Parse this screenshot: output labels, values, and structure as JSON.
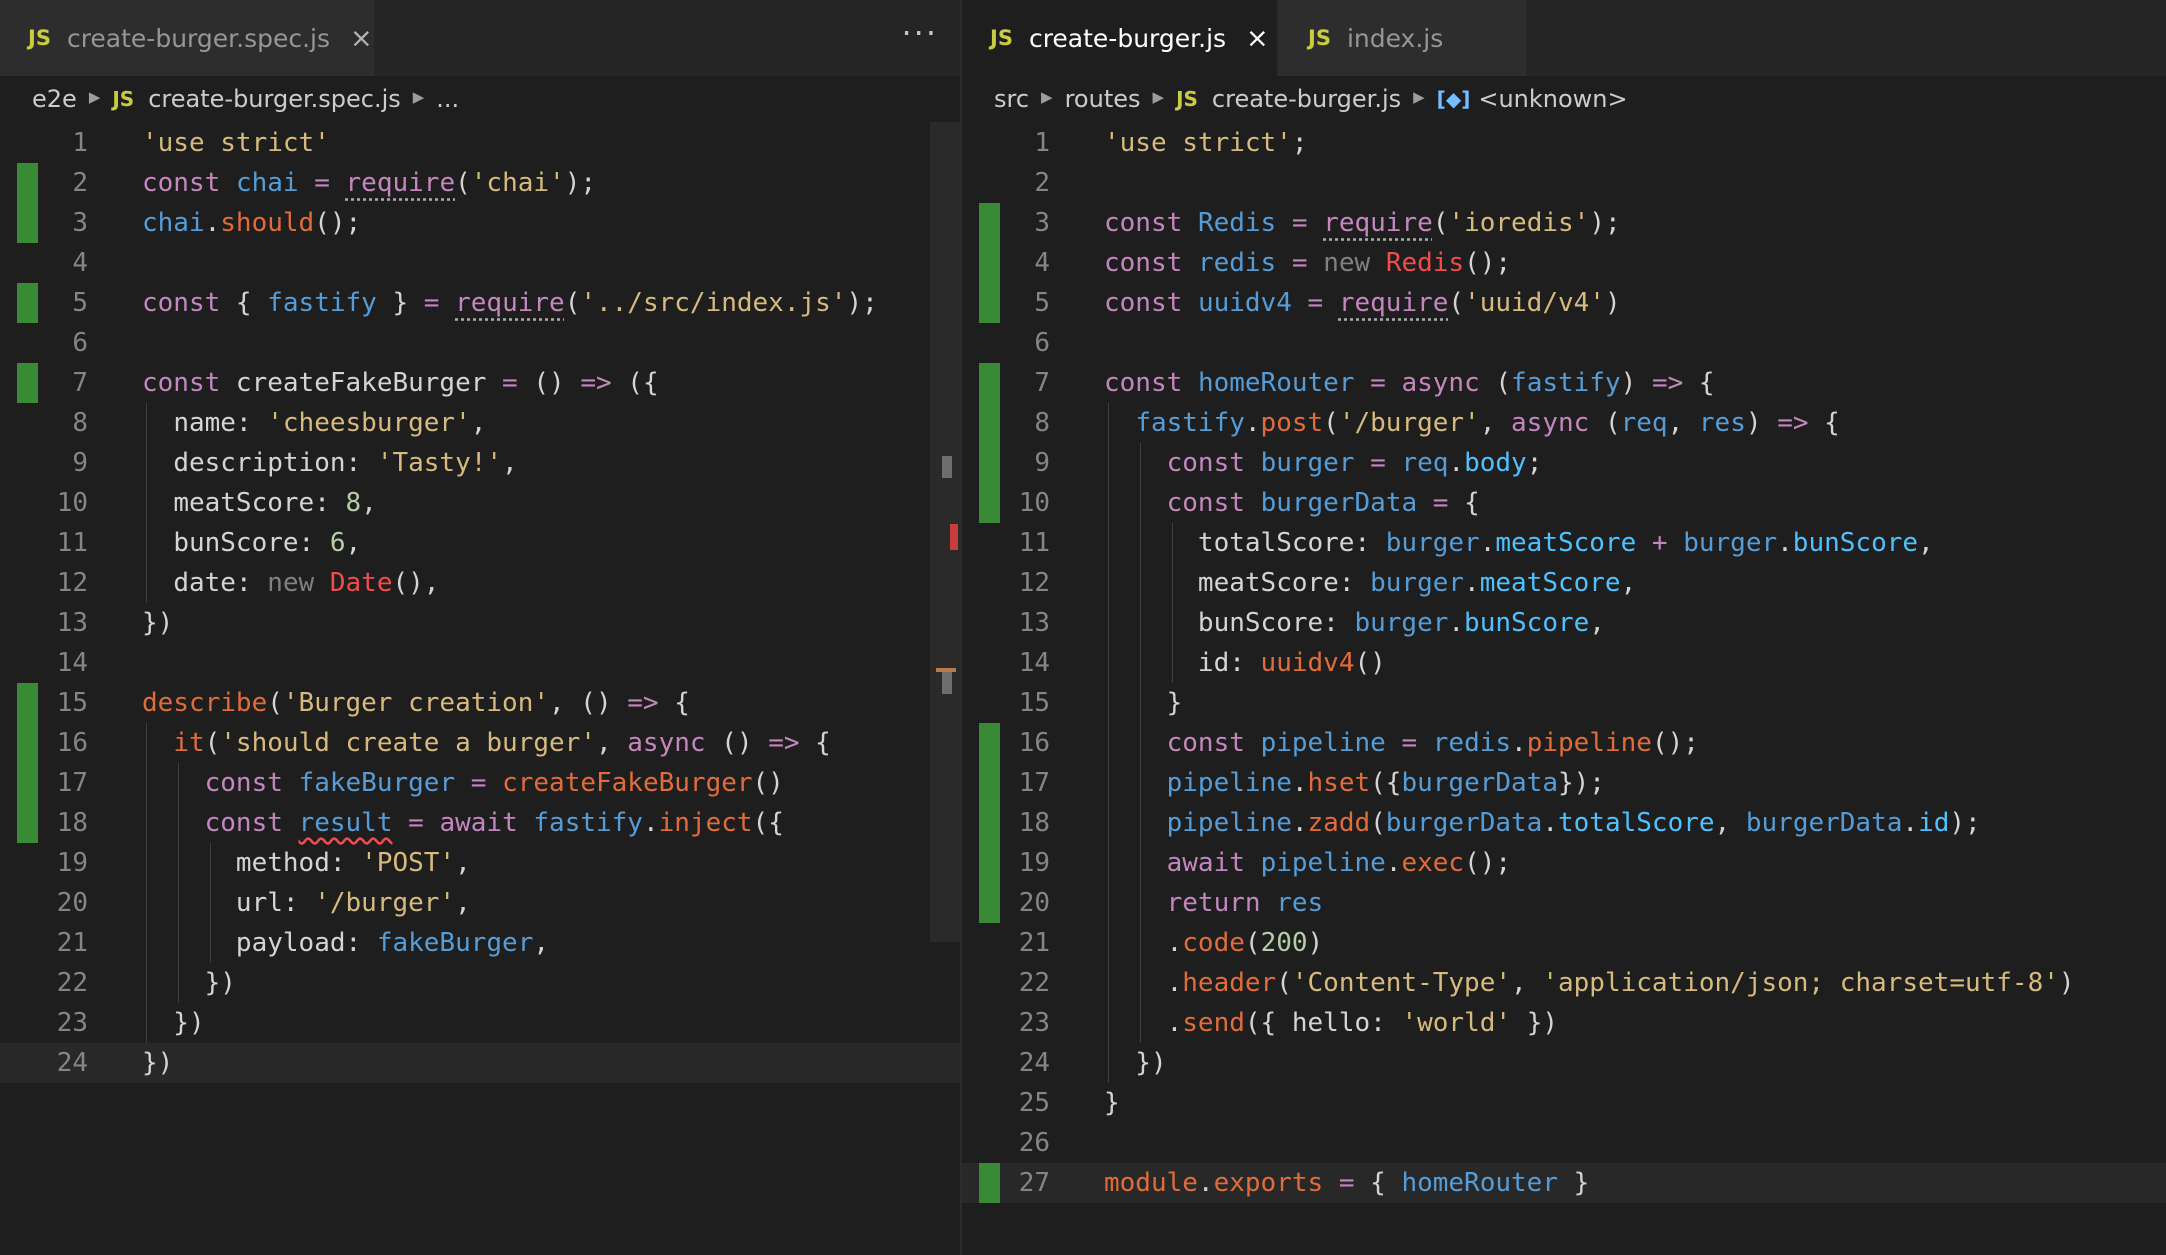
{
  "left_editor": {
    "tab": {
      "label": "create-burger.spec.js",
      "icon": "JS",
      "close": "×"
    },
    "more_actions": "···",
    "breadcrumb": {
      "folder": "e2e",
      "file": "create-burger.spec.js",
      "ellipsis": "..."
    },
    "lines": [
      {
        "n": "1",
        "text": "'use strict'"
      },
      {
        "n": "2",
        "text": "const chai = require('chai');"
      },
      {
        "n": "3",
        "text": "chai.should();"
      },
      {
        "n": "4",
        "text": ""
      },
      {
        "n": "5",
        "text": "const { fastify } = require('../src/index.js');"
      },
      {
        "n": "6",
        "text": ""
      },
      {
        "n": "7",
        "text": "const createFakeBurger = () => ({"
      },
      {
        "n": "8",
        "text": "  name: 'cheesburger',"
      },
      {
        "n": "9",
        "text": "  description: 'Tasty!',"
      },
      {
        "n": "10",
        "text": "  meatScore: 8,"
      },
      {
        "n": "11",
        "text": "  bunScore: 6,"
      },
      {
        "n": "12",
        "text": "  date: new Date(),"
      },
      {
        "n": "13",
        "text": "})"
      },
      {
        "n": "14",
        "text": ""
      },
      {
        "n": "15",
        "text": "describe('Burger creation', () => {"
      },
      {
        "n": "16",
        "text": "  it('should create a burger', async () => {"
      },
      {
        "n": "17",
        "text": "    const fakeBurger = createFakeBurger()"
      },
      {
        "n": "18",
        "text": "    const result = await fastify.inject({"
      },
      {
        "n": "19",
        "text": "      method: 'POST',"
      },
      {
        "n": "20",
        "text": "      url: '/burger',"
      },
      {
        "n": "21",
        "text": "      payload: fakeBurger,"
      },
      {
        "n": "22",
        "text": "    })"
      },
      {
        "n": "23",
        "text": "  })"
      },
      {
        "n": "24",
        "text": "})"
      }
    ]
  },
  "right_editor": {
    "tabs": [
      {
        "label": "create-burger.js",
        "icon": "JS",
        "close": "×"
      },
      {
        "label": "index.js",
        "icon": "JS"
      }
    ],
    "breadcrumb": {
      "parts": [
        "src",
        "routes"
      ],
      "file": "create-burger.js",
      "symbol_icon": "[◆]",
      "symbol": "<unknown>"
    },
    "lines": [
      {
        "n": "1",
        "text": "'use strict';"
      },
      {
        "n": "2",
        "text": ""
      },
      {
        "n": "3",
        "text": "const Redis = require('ioredis');"
      },
      {
        "n": "4",
        "text": "const redis = new Redis();"
      },
      {
        "n": "5",
        "text": "const uuidv4 = require('uuid/v4')"
      },
      {
        "n": "6",
        "text": ""
      },
      {
        "n": "7",
        "text": "const homeRouter = async (fastify) => {"
      },
      {
        "n": "8",
        "text": "  fastify.post('/burger', async (req, res) => {"
      },
      {
        "n": "9",
        "text": "    const burger = req.body;"
      },
      {
        "n": "10",
        "text": "    const burgerData = {"
      },
      {
        "n": "11",
        "text": "      totalScore: burger.meatScore + burger.bunScore,"
      },
      {
        "n": "12",
        "text": "      meatScore: burger.meatScore,"
      },
      {
        "n": "13",
        "text": "      bunScore: burger.bunScore,"
      },
      {
        "n": "14",
        "text": "      id: uuidv4()"
      },
      {
        "n": "15",
        "text": "    }"
      },
      {
        "n": "16",
        "text": "    const pipeline = redis.pipeline();"
      },
      {
        "n": "17",
        "text": "    pipeline.hset({burgerData});"
      },
      {
        "n": "18",
        "text": "    pipeline.zadd(burgerData.totalScore, burgerData.id);"
      },
      {
        "n": "19",
        "text": "    await pipeline.exec();"
      },
      {
        "n": "20",
        "text": "    return res"
      },
      {
        "n": "21",
        "text": "    .code(200)"
      },
      {
        "n": "22",
        "text": "    .header('Content-Type', 'application/json; charset=utf-8')"
      },
      {
        "n": "23",
        "text": "    .send({ hello: 'world' })"
      },
      {
        "n": "24",
        "text": "  })"
      },
      {
        "n": "25",
        "text": "}"
      },
      {
        "n": "26",
        "text": ""
      },
      {
        "n": "27",
        "text": "module.exports = { homeRouter }"
      }
    ]
  },
  "colors": {
    "keyword": "#c586c0",
    "variable": "#569cd6",
    "property": "#4fc1ff",
    "function": "#e06c3c",
    "string": "#d7ba7d",
    "number": "#b5cea8",
    "error": "#f14c4c",
    "gutter_added": "#388a34"
  }
}
